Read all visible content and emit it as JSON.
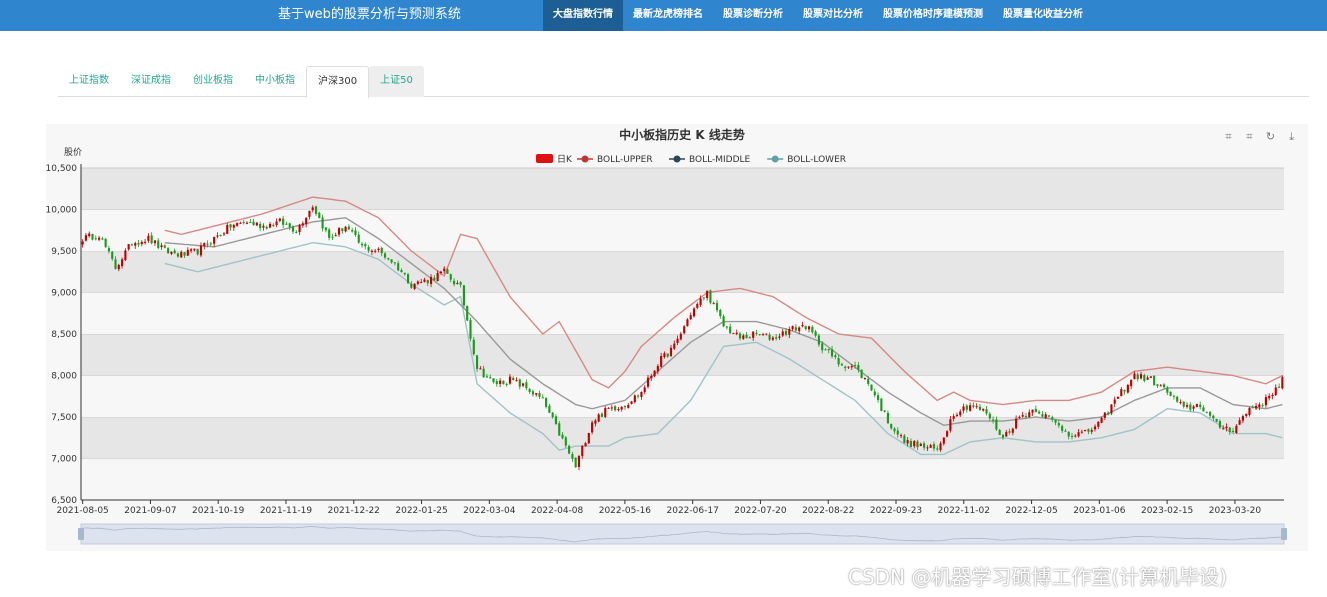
{
  "navbar": {
    "brand": "基于web的股票分析与预测系统",
    "items": [
      {
        "label": "大盘指数行情",
        "active": true
      },
      {
        "label": "最新龙虎榜排名"
      },
      {
        "label": "股票诊断分析"
      },
      {
        "label": "股票对比分析"
      },
      {
        "label": "股票价格时序建模预测"
      },
      {
        "label": "股票量化收益分析"
      }
    ]
  },
  "tabs": [
    {
      "label": "上证指数"
    },
    {
      "label": "深证成指"
    },
    {
      "label": "创业板指"
    },
    {
      "label": "中小板指"
    },
    {
      "label": "沪深300",
      "active": true
    },
    {
      "label": "上证50",
      "hover": true
    }
  ],
  "watermark": "CSDN @机器学习硕博工作室(计算机毕设)",
  "chart_data": {
    "type": "candlestick",
    "title": "中小板指历史 K 线走势",
    "ylabel": "股价",
    "ylim": [
      6500,
      10500
    ],
    "yticks": [
      "6,500",
      "7,000",
      "7,500",
      "8,000",
      "8,500",
      "9,000",
      "9,500",
      "10,000",
      "10,500"
    ],
    "xticks": [
      "2021-08-05",
      "2021-09-07",
      "2021-10-19",
      "2021-11-19",
      "2021-12-22",
      "2022-01-25",
      "2022-03-04",
      "2022-04-08",
      "2022-05-16",
      "2022-06-17",
      "2022-07-20",
      "2022-08-22",
      "2022-09-23",
      "2022-11-02",
      "2022-12-05",
      "2023-01-06",
      "2023-02-15",
      "2023-03-20"
    ],
    "legend": [
      {
        "name": "日K",
        "color": "#e01010"
      },
      {
        "name": "BOLL-UPPER",
        "color": "#c23531"
      },
      {
        "name": "BOLL-MIDDLE",
        "color": "#2f4554"
      },
      {
        "name": "BOLL-LOWER",
        "color": "#61a0a8"
      }
    ],
    "colors": {
      "up": "#c00000",
      "down": "#1a9a1a",
      "upper": "#d48a85",
      "middle": "#999999",
      "lower": "#9fc4c8"
    },
    "close_keypoints": [
      [
        0,
        9650
      ],
      [
        5,
        9700
      ],
      [
        10,
        9300
      ],
      [
        15,
        9600
      ],
      [
        20,
        9650
      ],
      [
        25,
        9500
      ],
      [
        30,
        9450
      ],
      [
        35,
        9500
      ],
      [
        40,
        9650
      ],
      [
        45,
        9800
      ],
      [
        50,
        9850
      ],
      [
        55,
        9800
      ],
      [
        60,
        9850
      ],
      [
        65,
        9750
      ],
      [
        70,
        10050
      ],
      [
        75,
        9650
      ],
      [
        80,
        9800
      ],
      [
        85,
        9550
      ],
      [
        90,
        9500
      ],
      [
        95,
        9350
      ],
      [
        100,
        9100
      ],
      [
        105,
        9150
      ],
      [
        110,
        9250
      ],
      [
        115,
        9050
      ],
      [
        120,
        8100
      ],
      [
        125,
        7900
      ],
      [
        130,
        7950
      ],
      [
        135,
        7850
      ],
      [
        140,
        7700
      ],
      [
        145,
        7300
      ],
      [
        150,
        6900
      ],
      [
        155,
        7450
      ],
      [
        160,
        7600
      ],
      [
        165,
        7650
      ],
      [
        170,
        7800
      ],
      [
        175,
        8150
      ],
      [
        180,
        8350
      ],
      [
        185,
        8750
      ],
      [
        190,
        9000
      ],
      [
        195,
        8600
      ],
      [
        200,
        8450
      ],
      [
        205,
        8500
      ],
      [
        210,
        8450
      ],
      [
        215,
        8550
      ],
      [
        220,
        8600
      ],
      [
        225,
        8350
      ],
      [
        230,
        8150
      ],
      [
        235,
        8100
      ],
      [
        240,
        7850
      ],
      [
        245,
        7450
      ],
      [
        250,
        7200
      ],
      [
        255,
        7150
      ],
      [
        260,
        7100
      ],
      [
        265,
        7550
      ],
      [
        270,
        7650
      ],
      [
        275,
        7550
      ],
      [
        280,
        7250
      ],
      [
        285,
        7500
      ],
      [
        290,
        7600
      ],
      [
        295,
        7450
      ],
      [
        300,
        7300
      ],
      [
        305,
        7300
      ],
      [
        310,
        7450
      ],
      [
        315,
        7750
      ],
      [
        320,
        8000
      ],
      [
        325,
        7950
      ],
      [
        330,
        7800
      ],
      [
        335,
        7600
      ],
      [
        340,
        7650
      ],
      [
        345,
        7400
      ],
      [
        350,
        7350
      ],
      [
        355,
        7600
      ],
      [
        360,
        7700
      ],
      [
        365,
        7950
      ]
    ],
    "boll_upper_keypoints": [
      [
        25,
        9750
      ],
      [
        30,
        9700
      ],
      [
        40,
        9800
      ],
      [
        55,
        9950
      ],
      [
        70,
        10150
      ],
      [
        80,
        10100
      ],
      [
        90,
        9900
      ],
      [
        100,
        9500
      ],
      [
        110,
        9200
      ],
      [
        115,
        9700
      ],
      [
        120,
        9650
      ],
      [
        130,
        8950
      ],
      [
        140,
        8500
      ],
      [
        145,
        8650
      ],
      [
        150,
        8300
      ],
      [
        155,
        7950
      ],
      [
        160,
        7850
      ],
      [
        165,
        8050
      ],
      [
        170,
        8350
      ],
      [
        180,
        8700
      ],
      [
        190,
        9000
      ],
      [
        200,
        9050
      ],
      [
        210,
        8950
      ],
      [
        220,
        8700
      ],
      [
        230,
        8500
      ],
      [
        240,
        8450
      ],
      [
        250,
        8050
      ],
      [
        260,
        7700
      ],
      [
        265,
        7800
      ],
      [
        270,
        7700
      ],
      [
        280,
        7650
      ],
      [
        290,
        7700
      ],
      [
        300,
        7700
      ],
      [
        310,
        7800
      ],
      [
        320,
        8050
      ],
      [
        330,
        8100
      ],
      [
        340,
        8050
      ],
      [
        350,
        8000
      ],
      [
        360,
        7900
      ],
      [
        365,
        8000
      ]
    ],
    "boll_middle_keypoints": [
      [
        25,
        9600
      ],
      [
        40,
        9550
      ],
      [
        55,
        9700
      ],
      [
        70,
        9850
      ],
      [
        80,
        9900
      ],
      [
        90,
        9650
      ],
      [
        100,
        9350
      ],
      [
        110,
        9050
      ],
      [
        120,
        8650
      ],
      [
        130,
        8200
      ],
      [
        140,
        7900
      ],
      [
        150,
        7650
      ],
      [
        155,
        7600
      ],
      [
        165,
        7700
      ],
      [
        175,
        8050
      ],
      [
        185,
        8400
      ],
      [
        195,
        8650
      ],
      [
        205,
        8650
      ],
      [
        215,
        8550
      ],
      [
        225,
        8400
      ],
      [
        235,
        8100
      ],
      [
        245,
        7800
      ],
      [
        255,
        7550
      ],
      [
        262,
        7400
      ],
      [
        270,
        7450
      ],
      [
        280,
        7450
      ],
      [
        290,
        7500
      ],
      [
        300,
        7450
      ],
      [
        310,
        7500
      ],
      [
        320,
        7700
      ],
      [
        330,
        7850
      ],
      [
        340,
        7850
      ],
      [
        350,
        7650
      ],
      [
        360,
        7600
      ],
      [
        365,
        7650
      ]
    ],
    "boll_lower_keypoints": [
      [
        25,
        9350
      ],
      [
        35,
        9250
      ],
      [
        40,
        9300
      ],
      [
        55,
        9450
      ],
      [
        70,
        9600
      ],
      [
        80,
        9550
      ],
      [
        90,
        9400
      ],
      [
        100,
        9100
      ],
      [
        110,
        8850
      ],
      [
        115,
        8950
      ],
      [
        120,
        7900
      ],
      [
        130,
        7550
      ],
      [
        140,
        7300
      ],
      [
        145,
        7100
      ],
      [
        150,
        7150
      ],
      [
        160,
        7150
      ],
      [
        165,
        7250
      ],
      [
        175,
        7300
      ],
      [
        185,
        7700
      ],
      [
        195,
        8350
      ],
      [
        205,
        8400
      ],
      [
        215,
        8200
      ],
      [
        225,
        7950
      ],
      [
        235,
        7700
      ],
      [
        245,
        7300
      ],
      [
        255,
        7050
      ],
      [
        262,
        7050
      ],
      [
        270,
        7200
      ],
      [
        280,
        7250
      ],
      [
        290,
        7200
      ],
      [
        300,
        7200
      ],
      [
        310,
        7250
      ],
      [
        320,
        7350
      ],
      [
        330,
        7600
      ],
      [
        340,
        7550
      ],
      [
        350,
        7300
      ],
      [
        360,
        7300
      ],
      [
        365,
        7250
      ]
    ],
    "trading_days": 366,
    "datazoom": {
      "start": 0,
      "end": 100
    }
  }
}
